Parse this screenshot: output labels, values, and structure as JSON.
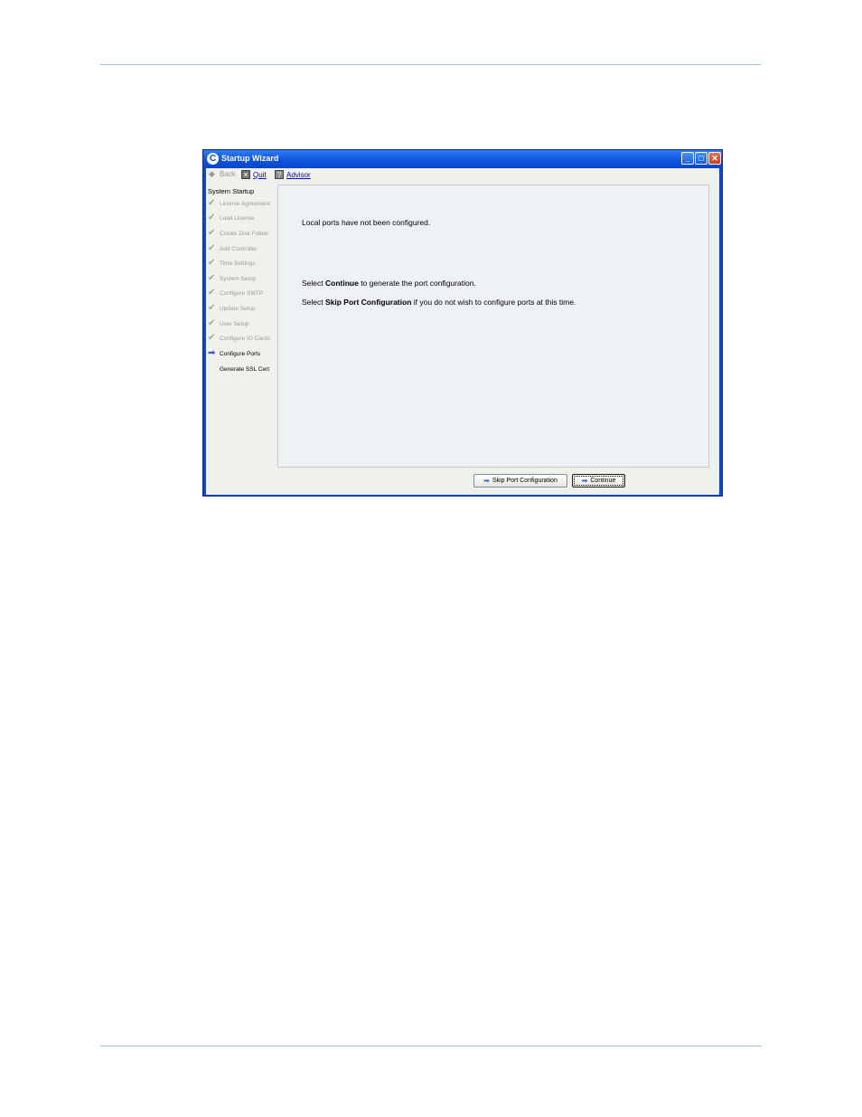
{
  "window": {
    "title": "Startup Wizard",
    "app_icon_glyph": "C"
  },
  "toolbar": {
    "back_label": "Back",
    "quit_label": "Quit",
    "advisor_label": "Advisor",
    "back_icon": "back-arrow-icon",
    "quit_icon": "quit-icon",
    "advisor_icon": "advisor-icon"
  },
  "sidebar": {
    "title": "System Startup",
    "steps": [
      {
        "label": "License Agreement",
        "state": "done"
      },
      {
        "label": "Load License",
        "state": "done"
      },
      {
        "label": "Create Disk Folder",
        "state": "done"
      },
      {
        "label": "Add Controller",
        "state": "done"
      },
      {
        "label": "Time Settings",
        "state": "done"
      },
      {
        "label": "System Setup",
        "state": "done"
      },
      {
        "label": "Configure SMTP",
        "state": "done"
      },
      {
        "label": "Update Setup",
        "state": "done"
      },
      {
        "label": "User Setup",
        "state": "done"
      },
      {
        "label": "Configure IO Cards",
        "state": "done"
      },
      {
        "label": "Configure Ports",
        "state": "current"
      },
      {
        "label": "Generate SSL Cert",
        "state": "pending"
      }
    ]
  },
  "content": {
    "line1": "Local ports have not been configured.",
    "line2_prefix": "Select ",
    "line2_bold": "Continue",
    "line2_suffix": " to generate the port configuration.",
    "line3_prefix": "Select ",
    "line3_bold": "Skip Port Configuration",
    "line3_suffix": " if you do not wish to configure ports at this time."
  },
  "buttons": {
    "skip_label": "Skip Port Configuration",
    "continue_label": "Continue"
  },
  "colors": {
    "title_bar": "#0a52dc",
    "rule": "#9fc3d3",
    "accent_arrow": "#2a60d0"
  }
}
